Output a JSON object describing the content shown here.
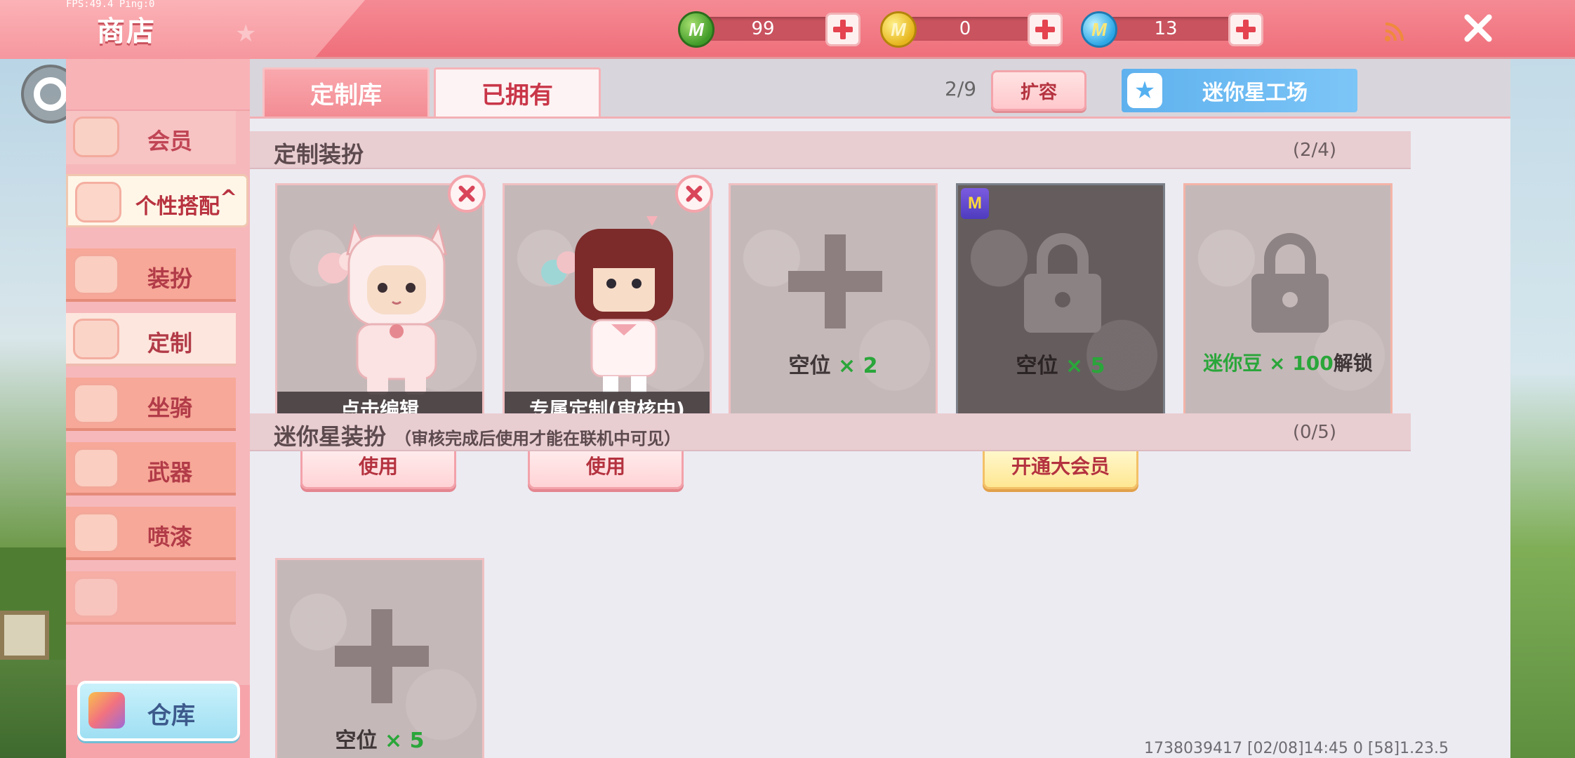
{
  "debug": {
    "fps": "FPS:49.4  Ping:0"
  },
  "header": {
    "title": "商店"
  },
  "currencies": [
    {
      "icon": "green-mini-coin-icon",
      "value": "99"
    },
    {
      "icon": "gold-mini-coin-icon",
      "value": "0"
    },
    {
      "icon": "blue-mini-coin-icon",
      "value": "13"
    }
  ],
  "sidebar": {
    "items": [
      {
        "label": "会员",
        "icon": "vip-icon"
      },
      {
        "label": "个性搭配",
        "icon": "style-icon",
        "expanded": true
      },
      {
        "label": "装扮",
        "icon": "shirt-icon"
      },
      {
        "label": "定制",
        "icon": "customize-icon",
        "selected": true
      },
      {
        "label": "坐骑",
        "icon": "mount-icon"
      },
      {
        "label": "武器",
        "icon": "weapon-icon"
      },
      {
        "label": "喷漆",
        "icon": "spray-icon"
      }
    ],
    "warehouse_label": "仓库"
  },
  "tabs": [
    {
      "label": "定制库",
      "active": true
    },
    {
      "label": "已拥有",
      "active": false
    }
  ],
  "toolbar": {
    "capacity": "2/9",
    "expand_label": "扩容",
    "factory_label": "迷你星工场"
  },
  "custom_section": {
    "title": "定制装扮",
    "count": "(2/4)",
    "slots": [
      {
        "caption": "点击编辑",
        "button": "使用"
      },
      {
        "caption": "专属定制(审核中)",
        "button": "使用"
      },
      {
        "text_prefix": "空位",
        "text_count": "× 2"
      },
      {
        "text_prefix": "空位",
        "text_count": "× 5",
        "badge": "M",
        "button": "开通大会员"
      },
      {
        "unlock_item": "迷你豆 × 100",
        "unlock_suffix": "解锁"
      }
    ]
  },
  "star_section": {
    "title": "迷你星装扮",
    "note": "（审核完成后使用才能在联机中可见）",
    "count": "(0/5)",
    "slots": [
      {
        "text_prefix": "空位",
        "text_count": "× 5"
      }
    ]
  },
  "footer": {
    "info": "1738039417    [02/08]14:45 0  [58]1.23.5"
  }
}
